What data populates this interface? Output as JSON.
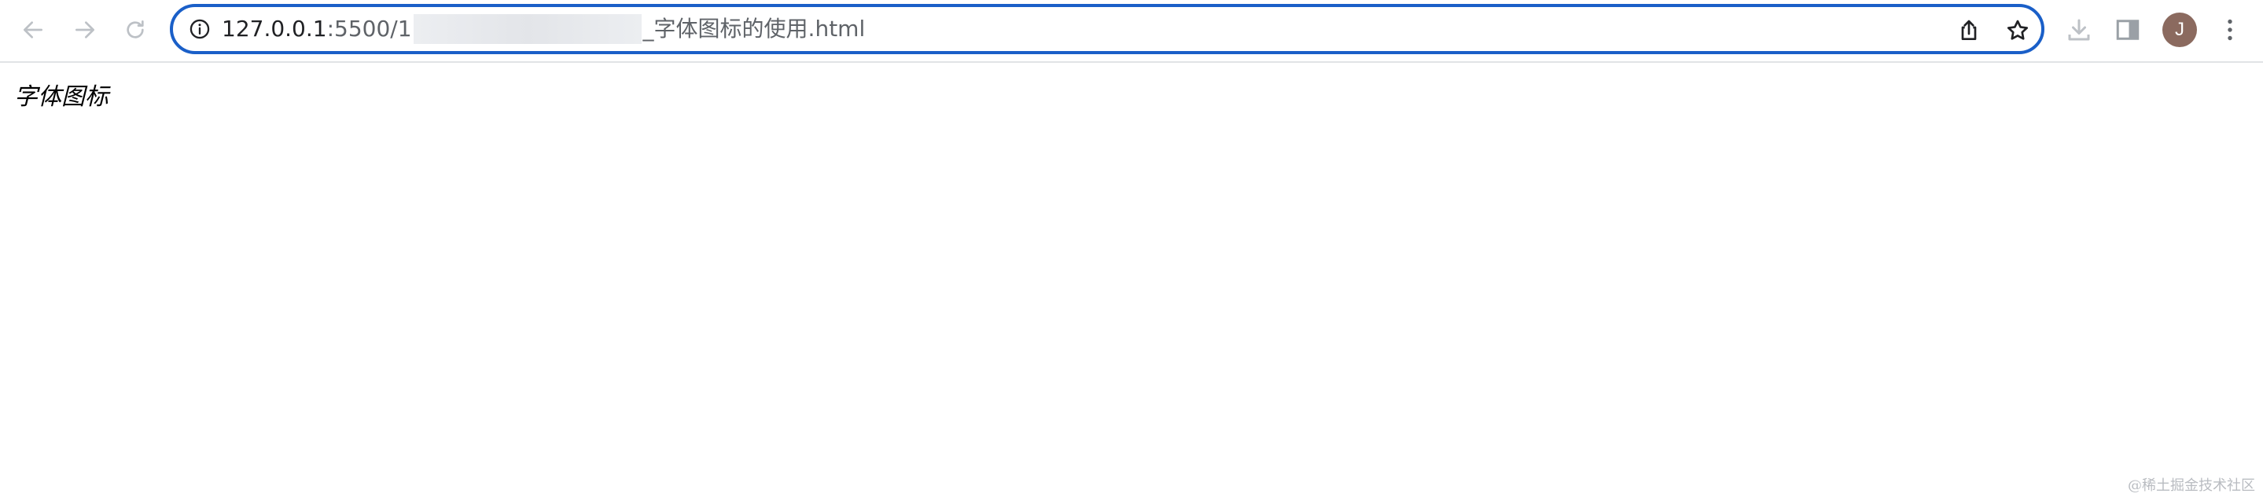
{
  "browser": {
    "url": {
      "host": "127.0.0.1",
      "port_prefix": ":5500/1",
      "file": "_字体图标的使用.html"
    },
    "profile_initial": "J",
    "icons": {
      "back": "arrow-left-icon",
      "forward": "arrow-right-icon",
      "reload": "reload-icon",
      "site_info": "info-icon",
      "share": "share-icon",
      "bookmark": "star-icon",
      "downloads": "download-icon",
      "side_panel": "side-panel-icon",
      "menu": "kebab-menu-icon"
    },
    "colors": {
      "focus_ring": "#1a5fc8",
      "avatar_bg": "#8b6a5f"
    }
  },
  "page": {
    "heading": "字体图标"
  },
  "watermark": "@稀土掘金技术社区"
}
